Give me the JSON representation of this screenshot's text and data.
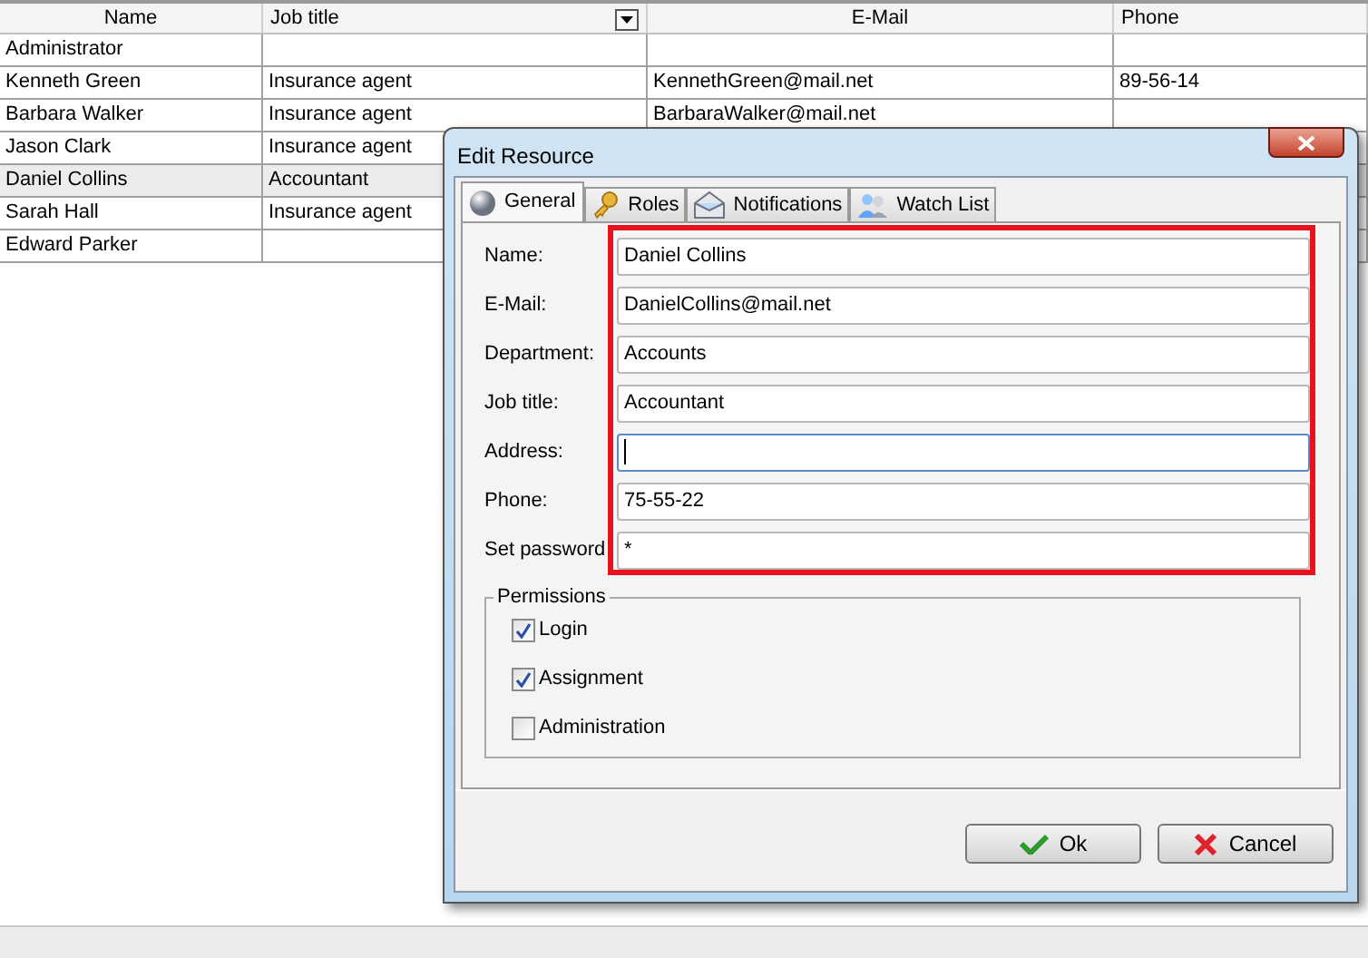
{
  "table": {
    "columns": [
      {
        "label": "Name",
        "filter": false
      },
      {
        "label": "Job title",
        "filter": true
      },
      {
        "label": "E-Mail",
        "filter": false
      },
      {
        "label": "Phone",
        "filter": false
      }
    ],
    "rows": [
      {
        "selected": false,
        "cells": [
          "Administrator"
        ]
      },
      {
        "selected": false,
        "cells": [
          "Kenneth Green",
          "Insurance agent",
          "KennethGreen@mail.net",
          "89-56-14"
        ]
      },
      {
        "selected": false,
        "cells": [
          "Barbara Walker",
          "Insurance agent",
          "BarbaraWalker@mail.net"
        ]
      },
      {
        "selected": false,
        "cells": [
          "Jason Clark",
          "Insurance agent"
        ]
      },
      {
        "selected": true,
        "cells": [
          "Daniel Collins",
          "Accountant"
        ]
      },
      {
        "selected": false,
        "cells": [
          "Sarah Hall",
          "Insurance agent"
        ]
      },
      {
        "selected": false,
        "cells": [
          "Edward Parker"
        ]
      }
    ]
  },
  "dialog": {
    "title": "Edit Resource",
    "tabs": [
      {
        "label": "General",
        "kind": "sphere",
        "selected": true
      },
      {
        "label": "Roles",
        "kind": "key",
        "selected": false
      },
      {
        "label": "Notifications",
        "kind": "envelope",
        "selected": false
      },
      {
        "label": "Watch List",
        "kind": "people",
        "selected": false
      }
    ],
    "fields": [
      {
        "label": "Name:",
        "value": "Daniel Collins",
        "focused": false
      },
      {
        "label": "E-Mail:",
        "value": "DanielCollins@mail.net",
        "focused": false
      },
      {
        "label": "Department:",
        "value": "Accounts",
        "focused": false
      },
      {
        "label": "Job title:",
        "value": "Accountant",
        "focused": false
      },
      {
        "label": "Address:",
        "focused": true
      },
      {
        "label": "Phone:",
        "value": "75-55-22",
        "focused": false
      },
      {
        "label": "Set password",
        "value": "*",
        "focused": false
      }
    ],
    "permissions": {
      "title": "Permissions",
      "items": [
        {
          "label": "Login",
          "checked": true
        },
        {
          "label": "Assignment",
          "checked": true
        },
        {
          "label": "Administration",
          "checked": false
        }
      ]
    },
    "buttons": [
      {
        "label": "Ok",
        "kind": "ok"
      },
      {
        "label": "Cancel",
        "kind": "cancel"
      }
    ]
  }
}
